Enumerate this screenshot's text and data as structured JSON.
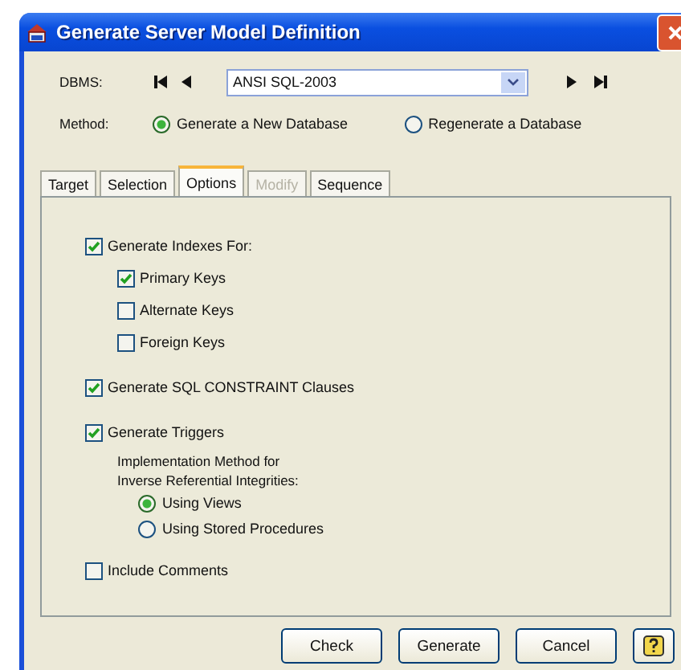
{
  "window": {
    "title": "Generate Server Model Definition"
  },
  "dbms": {
    "label": "DBMS:",
    "value": "ANSI SQL-2003"
  },
  "method": {
    "label": "Method:",
    "options": [
      {
        "label": "Generate a New Database",
        "selected": true
      },
      {
        "label": "Regenerate a Database",
        "selected": false
      }
    ]
  },
  "tabs": [
    {
      "label": "Target",
      "selected": false,
      "disabled": false
    },
    {
      "label": "Selection",
      "selected": false,
      "disabled": false
    },
    {
      "label": "Options",
      "selected": true,
      "disabled": false
    },
    {
      "label": "Modify",
      "selected": false,
      "disabled": true
    },
    {
      "label": "Sequence",
      "selected": false,
      "disabled": false
    }
  ],
  "options": [
    {
      "kind": "checkbox",
      "label": "Generate Indexes For:",
      "checked": true,
      "children": [
        {
          "kind": "checkbox",
          "label": "Primary Keys",
          "checked": true
        },
        {
          "kind": "checkbox",
          "label": "Alternate Keys",
          "checked": false
        },
        {
          "kind": "checkbox",
          "label": "Foreign Keys",
          "checked": false
        }
      ]
    },
    {
      "kind": "checkbox",
      "label": "Generate SQL CONSTRAINT Clauses",
      "checked": true
    },
    {
      "kind": "checkbox",
      "label": "Generate Triggers",
      "checked": true,
      "children": [
        {
          "kind": "note",
          "lines": [
            "Implementation Method for",
            "Inverse Referential Integrities:"
          ],
          "children": [
            {
              "kind": "radio",
              "label": "Using Views",
              "selected": true
            },
            {
              "kind": "radio",
              "label": "Using Stored Procedures",
              "selected": false
            }
          ]
        }
      ]
    },
    {
      "kind": "checkbox",
      "label": "Include Comments",
      "checked": false
    }
  ],
  "buttons": [
    "Check",
    "Generate",
    "Cancel"
  ]
}
